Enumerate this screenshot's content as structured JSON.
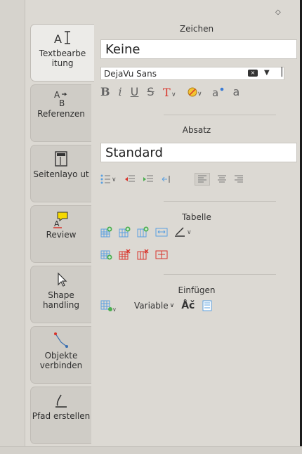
{
  "tabs": [
    {
      "label": "Textbearbe itung",
      "icon": "text-cursor-icon",
      "active": true
    },
    {
      "label": "Referenzen",
      "icon": "reference-icon",
      "active": false
    },
    {
      "label": "Seitenlayo ut",
      "icon": "page-layout-icon",
      "active": false
    },
    {
      "label": "Review",
      "icon": "comment-icon",
      "active": false
    },
    {
      "label": "Shape handling",
      "icon": "pointer-icon",
      "active": false
    },
    {
      "label": "Objekte verbinden",
      "icon": "connector-icon",
      "active": false
    },
    {
      "label": "Pfad erstellen",
      "icon": "path-icon",
      "active": false
    }
  ],
  "zeichen": {
    "title": "Zeichen",
    "style_value": "Keine",
    "font_name": "DejaVu Sans"
  },
  "absatz": {
    "title": "Absatz",
    "style_value": "Standard"
  },
  "tabelle": {
    "title": "Tabelle"
  },
  "einfuegen": {
    "title": "Einfügen",
    "variable_label": "Variable",
    "special_char": "Åč"
  },
  "colors": {
    "accent_blue": "#3a7bd5",
    "accent_green": "#4caf50",
    "accent_red": "#d9342b"
  }
}
